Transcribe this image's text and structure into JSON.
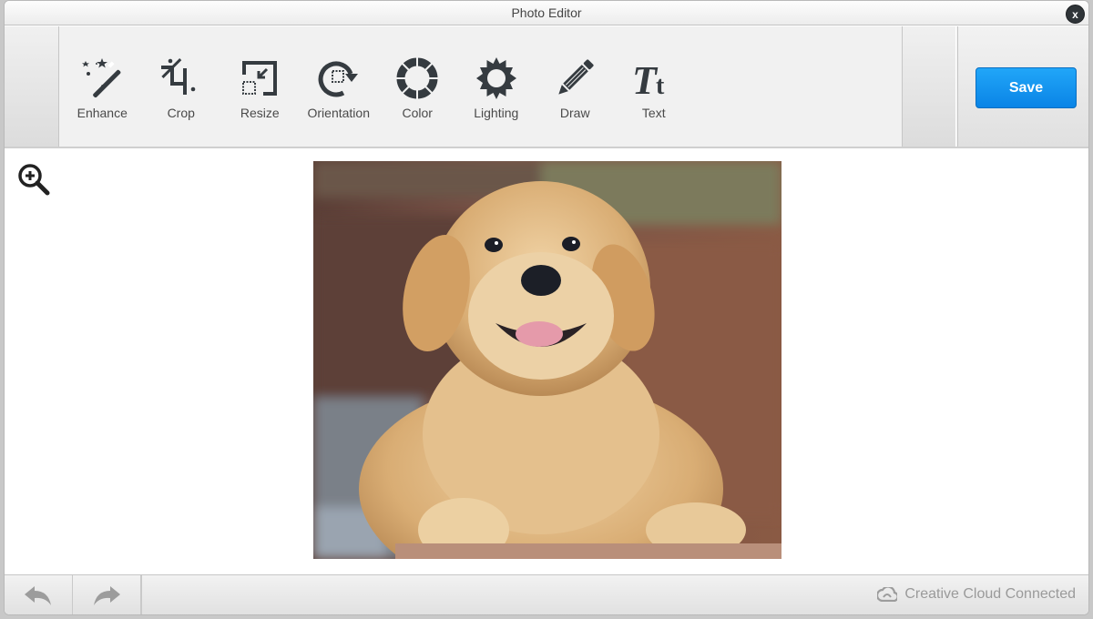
{
  "window": {
    "title": "Photo Editor",
    "close_label": "x"
  },
  "toolbar": {
    "tools": [
      {
        "label": "Enhance",
        "icon": "magic-wand-icon"
      },
      {
        "label": "Crop",
        "icon": "crop-icon"
      },
      {
        "label": "Resize",
        "icon": "resize-icon"
      },
      {
        "label": "Orientation",
        "icon": "rotate-icon"
      },
      {
        "label": "Color",
        "icon": "color-wheel-icon"
      },
      {
        "label": "Lighting",
        "icon": "sun-icon"
      },
      {
        "label": "Draw",
        "icon": "pencil-icon"
      },
      {
        "label": "Text",
        "icon": "text-icon"
      }
    ],
    "save_label": "Save",
    "save_color": "#0a8fee"
  },
  "canvas": {
    "zoom_icon": "zoom-in-icon",
    "photo_alt": "Golden retriever puppy"
  },
  "footer": {
    "undo_icon": "undo-icon",
    "redo_icon": "redo-icon",
    "status_text": "Creative Cloud Connected",
    "status_icon": "creative-cloud-icon"
  },
  "colors": {
    "icon": "#353b40",
    "accent": "#0a8fee"
  }
}
